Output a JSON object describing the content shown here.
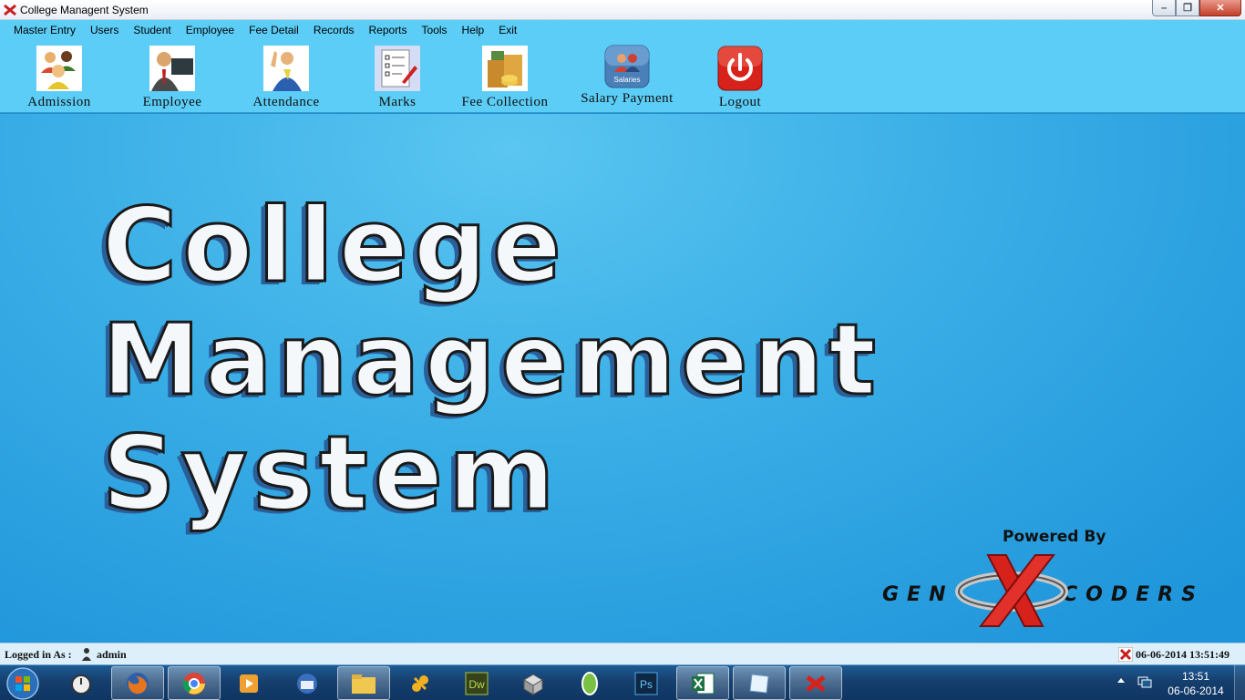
{
  "window": {
    "title": "College Managent System"
  },
  "menu": [
    "Master Entry",
    "Users",
    "Student",
    "Employee",
    "Fee Detail",
    "Records",
    "Reports",
    "Tools",
    "Help",
    "Exit"
  ],
  "toolbar": {
    "admission": "Admission",
    "employee": "Employee",
    "attendance": "Attendance",
    "marks": "Marks",
    "fee": "Fee Collection",
    "salary": "Salary Payment",
    "salary_badge": "Salaries",
    "logout": "Logout"
  },
  "banner": {
    "line1": "College",
    "line2": "Management",
    "line3": "System"
  },
  "brand": {
    "powered": "Powered By",
    "left": "GEN",
    "right": "CODERS"
  },
  "status": {
    "logged_label": "Logged in As :",
    "user": "admin",
    "datetime": "06-06-2014 13:51:49"
  },
  "taskbar": {
    "time": "13:51",
    "date": "06-06-2014"
  },
  "colors": {
    "menubar": "#5bcdf6",
    "main": "#1e94da",
    "accent_red": "#d7221b"
  }
}
